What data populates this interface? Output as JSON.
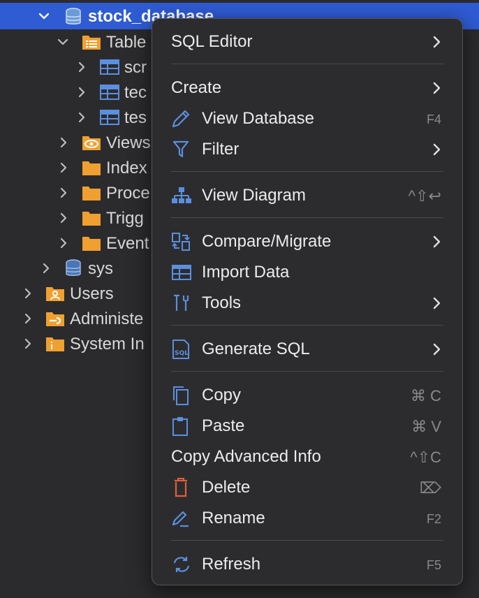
{
  "tree": {
    "root": "stock_database",
    "tables_folder": "Table",
    "tables": [
      "scr",
      "tec",
      "tes"
    ],
    "folders": [
      "Views",
      "Index",
      "Proce",
      "Trigg",
      "Event"
    ],
    "sys": "sys",
    "users": "Users",
    "admin": "Administe",
    "sysinfo": "System In"
  },
  "menu": {
    "sql_editor": "SQL Editor",
    "create": "Create",
    "view_database": "View Database",
    "view_database_shortcut": "F4",
    "filter": "Filter",
    "view_diagram": "View Diagram",
    "view_diagram_shortcut": "^⇧↩",
    "compare_migrate": "Compare/Migrate",
    "import_data": "Import Data",
    "tools": "Tools",
    "generate_sql": "Generate SQL",
    "copy": "Copy",
    "copy_shortcut": "⌘ C",
    "paste": "Paste",
    "paste_shortcut": "⌘ V",
    "copy_advanced_info": "Copy Advanced Info",
    "copy_advanced_info_shortcut": "^⇧C",
    "delete": "Delete",
    "delete_shortcut": "⌦",
    "rename": "Rename",
    "rename_shortcut": "F2",
    "refresh": "Refresh",
    "refresh_shortcut": "F5"
  },
  "colors": {
    "selection": "#2f5bd3",
    "folder": "#f0a030",
    "db_icon": "#6b9ad8",
    "menu_icon": "#5b8fe0",
    "delete_icon": "#e0603a"
  }
}
